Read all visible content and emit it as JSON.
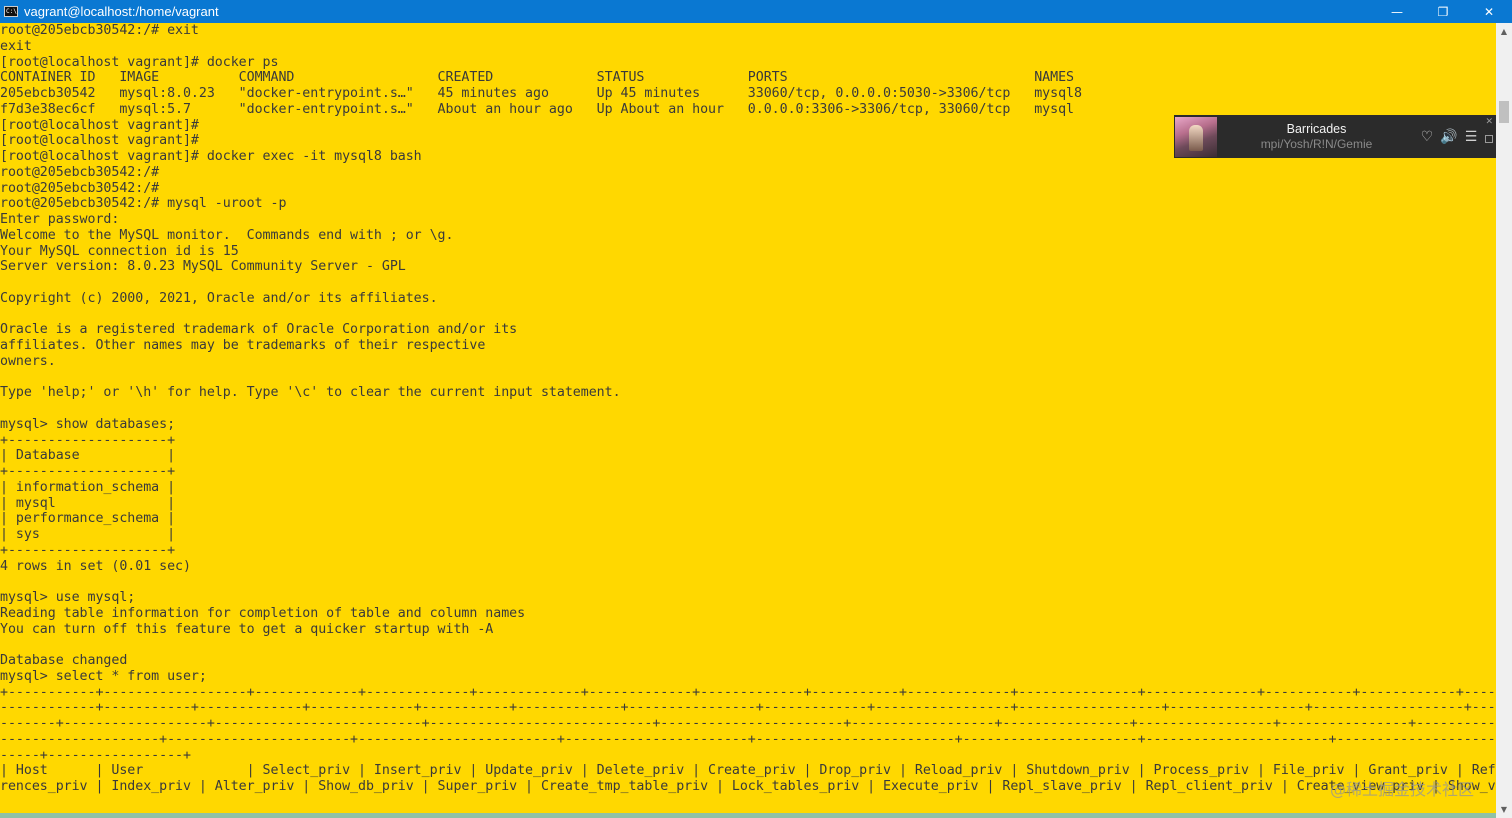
{
  "window": {
    "title": "vagrant@localhost:/home/vagrant",
    "app_icon_text": "C:\\",
    "minimize_glyph": "—",
    "restore_glyph": "❐",
    "close_glyph": "✕"
  },
  "terminal": {
    "text": "root@205ebcb30542:/# exit\nexit\n[root@localhost vagrant]# docker ps\nCONTAINER ID   IMAGE          COMMAND                  CREATED             STATUS             PORTS                               NAMES\n205ebcb30542   mysql:8.0.23   \"docker-entrypoint.s…\"   45 minutes ago      Up 45 minutes      33060/tcp, 0.0.0.0:5030->3306/tcp   mysql8\nf7d3e38ec6cf   mysql:5.7      \"docker-entrypoint.s…\"   About an hour ago   Up About an hour   0.0.0.0:3306->3306/tcp, 33060/tcp   mysql\n[root@localhost vagrant]#\n[root@localhost vagrant]#\n[root@localhost vagrant]# docker exec -it mysql8 bash\nroot@205ebcb30542:/#\nroot@205ebcb30542:/#\nroot@205ebcb30542:/# mysql -uroot -p\nEnter password:\nWelcome to the MySQL monitor.  Commands end with ; or \\g.\nYour MySQL connection id is 15\nServer version: 8.0.23 MySQL Community Server - GPL\n\nCopyright (c) 2000, 2021, Oracle and/or its affiliates.\n\nOracle is a registered trademark of Oracle Corporation and/or its\naffiliates. Other names may be trademarks of their respective\nowners.\n\nType 'help;' or '\\h' for help. Type '\\c' to clear the current input statement.\n\nmysql> show databases;\n+--------------------+\n| Database           |\n+--------------------+\n| information_schema |\n| mysql              |\n| performance_schema |\n| sys                |\n+--------------------+\n4 rows in set (0.01 sec)\n\nmysql> use mysql;\nReading table information for completion of table and column names\nYou can turn off this feature to get a quicker startup with -A\n\nDatabase changed\nmysql> select * from user;\n+-----------+------------------+-------------+-------------+-------------+-------------+-------------+-----------+-------------+---------------+--------------+-----------+------------+-----\n------------+-----------+-------------+-------------+-----------+-------------+----------------+-------------+-----------------+------------------+-----------------+-------------------+----\n-------+------------------+--------------------------+----------------------------+-----------------------+------------------+----------------+-----------------+----------------+----------\n--------------------+-----------------------+-------------------------+-----------------------+-------------------------+----------------------+-----------------------+--------------------\n-----+-----------------+\n| Host      | User             | Select_priv | Insert_priv | Update_priv | Delete_priv | Create_priv | Drop_priv | Reload_priv | Shutdown_priv | Process_priv | File_priv | Grant_priv | Refe\nrences_priv | Index_priv | Alter_priv | Show_db_priv | Super_priv | Create_tmp_table_priv | Lock_tables_priv | Execute_priv | Repl_slave_priv | Repl_client_priv | Create_view_priv | Show_vi"
  },
  "player": {
    "title": "Barricades",
    "artist": "mpi/Yosh/R!N/Gemie",
    "like_glyph": "♡",
    "volume_glyph": "🔊",
    "playlist_glyph": "☰",
    "close_glyph": "✕"
  },
  "scrollbar": {
    "up_glyph": "▲",
    "down_glyph": "▼"
  },
  "watermark": {
    "text": "@稀土掘金技术社区"
  }
}
